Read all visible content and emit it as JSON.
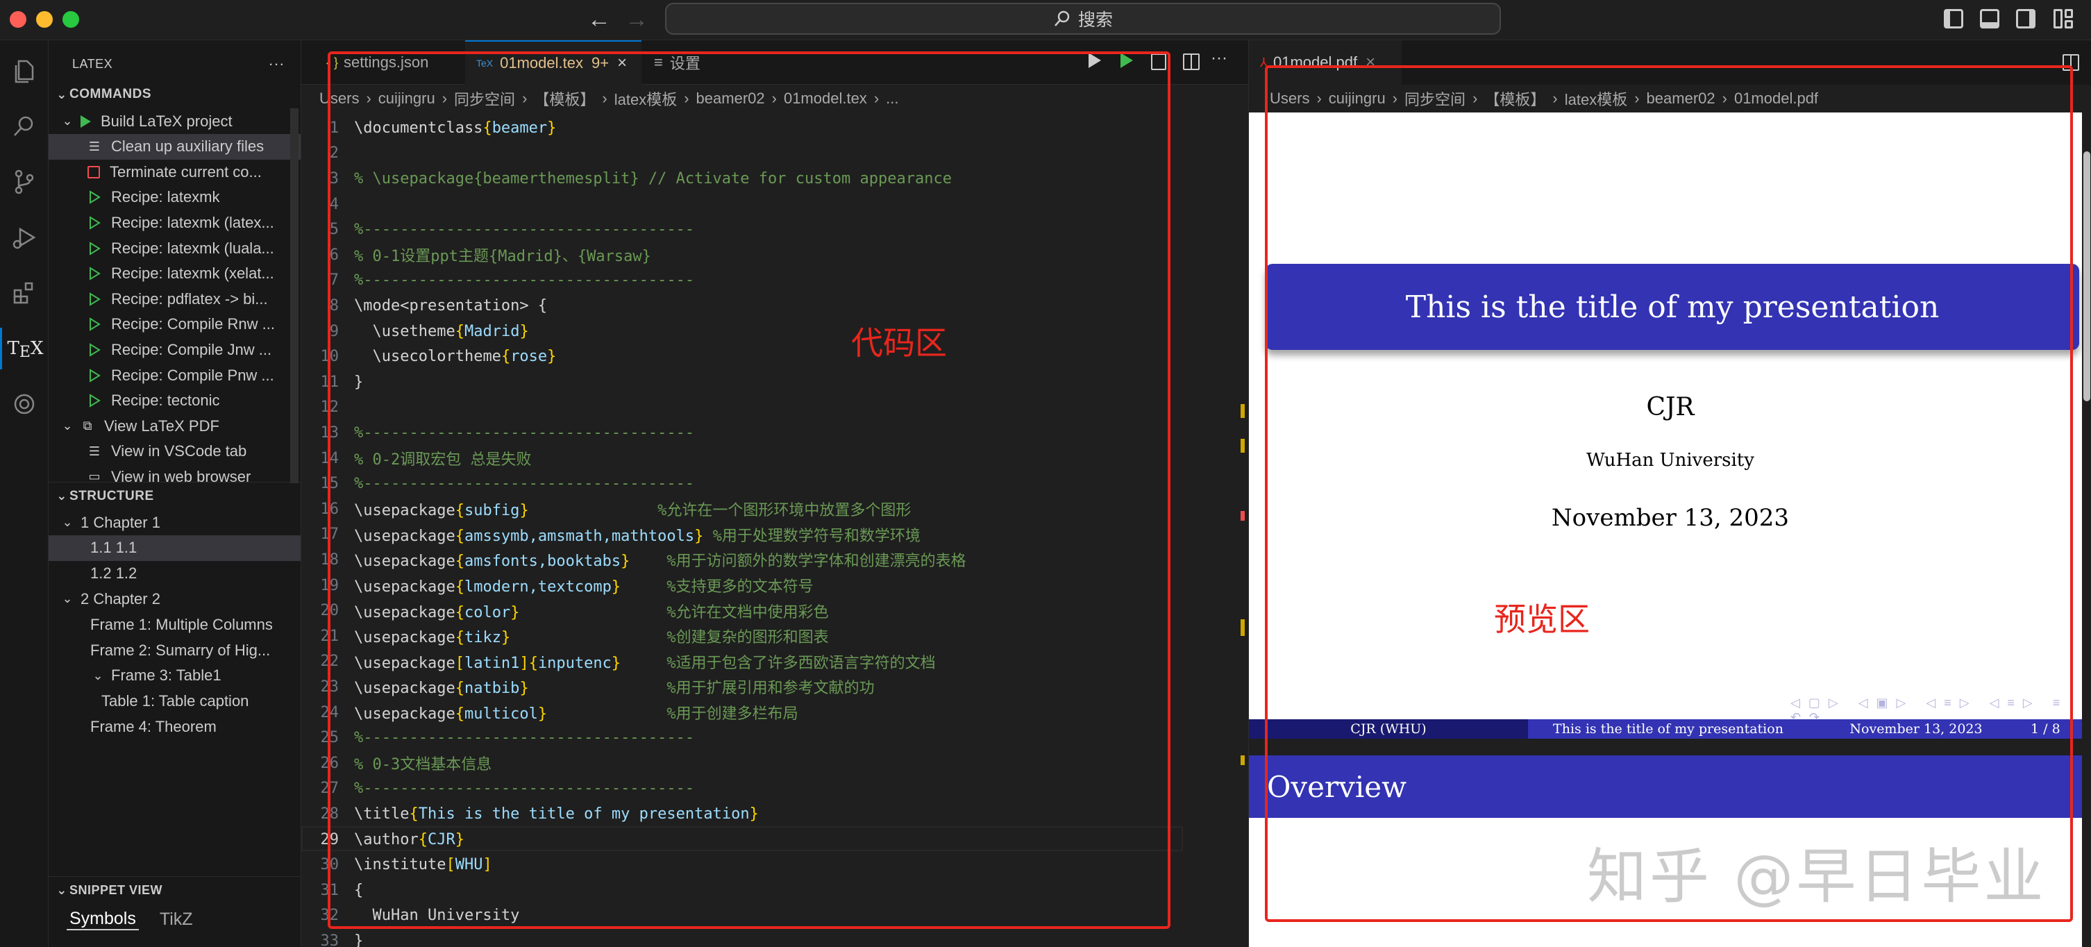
{
  "titlebar": {
    "search": "搜索"
  },
  "sidebar": {
    "view_title": "LATEX",
    "commands_header": "COMMANDS",
    "commands": [
      {
        "label": "Build LaTeX project",
        "icon": "play-icon",
        "indent": 1,
        "chevron": "v"
      },
      {
        "label": "Clean up auxiliary files",
        "icon": "list-icon",
        "indent": 2,
        "selected": true
      },
      {
        "label": "Terminate current co...",
        "icon": "stop-icon",
        "indent": 2
      },
      {
        "label": "Recipe: latexmk",
        "icon": "play-outline-icon",
        "indent": 2
      },
      {
        "label": "Recipe: latexmk (latex...",
        "icon": "play-outline-icon",
        "indent": 2
      },
      {
        "label": "Recipe: latexmk (luala...",
        "icon": "play-outline-icon",
        "indent": 2
      },
      {
        "label": "Recipe: latexmk (xelat...",
        "icon": "play-outline-icon",
        "indent": 2
      },
      {
        "label": "Recipe: pdflatex -> bi...",
        "icon": "play-outline-icon",
        "indent": 2
      },
      {
        "label": "Recipe: Compile Rnw ...",
        "icon": "play-outline-icon",
        "indent": 2
      },
      {
        "label": "Recipe: Compile Jnw ...",
        "icon": "play-outline-icon",
        "indent": 2
      },
      {
        "label": "Recipe: Compile Pnw ...",
        "icon": "play-outline-icon",
        "indent": 2
      },
      {
        "label": "Recipe: tectonic",
        "icon": "play-outline-icon",
        "indent": 2
      },
      {
        "label": "View LaTeX PDF",
        "icon": "preview-icon",
        "indent": 1,
        "chevron": "v"
      },
      {
        "label": "View in VSCode tab",
        "icon": "list-icon",
        "indent": 2
      },
      {
        "label": "View in web browser",
        "icon": "browser-icon",
        "indent": 2
      }
    ],
    "structure_header": "STRUCTURE",
    "structure": [
      {
        "label": "1  Chapter 1",
        "indent": 1,
        "chevron": "v"
      },
      {
        "label": "1.1 1.1",
        "indent": 2,
        "selected": true
      },
      {
        "label": "1.2 1.2",
        "indent": 2
      },
      {
        "label": "2  Chapter 2",
        "indent": 1,
        "chevron": "v"
      },
      {
        "label": "Frame 1: Multiple Columns",
        "indent": 2
      },
      {
        "label": "Frame 2: Sumarry of Hig...",
        "indent": 2
      },
      {
        "label": "Frame 3: Table1",
        "indent": 2,
        "chevron": "v"
      },
      {
        "label": "Table 1: Table caption",
        "indent": 3
      },
      {
        "label": "Frame 4: Theorem",
        "indent": 2
      }
    ],
    "snippet_header": "SNIPPET VIEW",
    "snippet_tabs": [
      "Symbols",
      "TikZ"
    ]
  },
  "editor": {
    "tabs": [
      {
        "label": "settings.json",
        "icon": "{ }"
      },
      {
        "label": "01model.tex",
        "badge": "9+",
        "icon": "TeX",
        "active": true
      },
      {
        "label": "设置",
        "icon": "≡"
      }
    ],
    "breadcrumb": [
      "Users",
      "cuijingru",
      "同步空间",
      "【模板】",
      "latex模板",
      "beamer02",
      "01model.tex",
      "..."
    ],
    "lines": [
      {
        "n": "1",
        "code": "\\documentclass{beamer}"
      },
      {
        "n": "2",
        "code": ""
      },
      {
        "n": "3",
        "code": "% \\usepackage{beamerthemesplit} // Activate for custom appearance"
      },
      {
        "n": "4",
        "code": ""
      },
      {
        "n": "5",
        "code": "%------------------------------------"
      },
      {
        "n": "6",
        "code": "% 0-1设置ppt主题{Madrid}、{Warsaw}"
      },
      {
        "n": "7",
        "code": "%------------------------------------"
      },
      {
        "n": "8",
        "code": "\\mode<presentation> {"
      },
      {
        "n": "9",
        "code": "  \\usetheme{Madrid}"
      },
      {
        "n": "10",
        "code": "  \\usecolortheme{rose}"
      },
      {
        "n": "11",
        "code": "}"
      },
      {
        "n": "12",
        "code": ""
      },
      {
        "n": "13",
        "code": "%------------------------------------"
      },
      {
        "n": "14",
        "code": "% 0-2调取宏包 总是失败"
      },
      {
        "n": "15",
        "code": "%------------------------------------"
      },
      {
        "n": "16",
        "code": "\\usepackage{subfig}              %允许在一个图形环境中放置多个图形"
      },
      {
        "n": "17",
        "code": "\\usepackage{amssymb,amsmath,mathtools} %用于处理数学符号和数学环境"
      },
      {
        "n": "18",
        "code": "\\usepackage{amsfonts,booktabs}    %用于访问额外的数学字体和创建漂亮的表格"
      },
      {
        "n": "19",
        "code": "\\usepackage{lmodern,textcomp}     %支持更多的文本符号"
      },
      {
        "n": "20",
        "code": "\\usepackage{color}                %允许在文档中使用彩色"
      },
      {
        "n": "21",
        "code": "\\usepackage{tikz}                 %创建复杂的图形和图表"
      },
      {
        "n": "22",
        "code": "\\usepackage[latin1]{inputenc}     %适用于包含了许多西欧语言字符的文档"
      },
      {
        "n": "23",
        "code": "\\usepackage{natbib}               %用于扩展引用和参考文献的功"
      },
      {
        "n": "24",
        "code": "\\usepackage{multicol}             %用于创建多栏布局"
      },
      {
        "n": "25",
        "code": "%------------------------------------"
      },
      {
        "n": "26",
        "code": "% 0-3文档基本信息"
      },
      {
        "n": "27",
        "code": "%------------------------------------"
      },
      {
        "n": "28",
        "code": "\\title{This is the title of my presentation}"
      },
      {
        "n": "29",
        "code": "\\author{CJR}",
        "current": true
      },
      {
        "n": "30",
        "code": "\\institute[WHU]"
      },
      {
        "n": "31",
        "code": "{"
      },
      {
        "n": "32",
        "code": "  WuHan University"
      },
      {
        "n": "33",
        "code": "}"
      }
    ]
  },
  "preview": {
    "tab": "01model.pdf",
    "breadcrumb": [
      "Users",
      "cuijingru",
      "同步空间",
      "【模板】",
      "latex模板",
      "beamer02",
      "01model.pdf"
    ],
    "slide": {
      "title": "This is the title of my presentation",
      "author": "CJR",
      "institute": "WuHan University",
      "date": "November 13, 2023",
      "footer": [
        "CJR  (WHU)",
        "This is the title of my presentation",
        "November 13, 2023",
        "1 / 8"
      ],
      "next_title": "Overview"
    }
  },
  "annotations": {
    "code_label": "代码区",
    "preview_label": "预览区",
    "watermark": "知乎 @早日毕业"
  },
  "colors": {
    "accent": "#0078d4",
    "annotation_red": "#e8261d",
    "beamer_blue": "#3333b3",
    "beamer_dark": "#191970",
    "tex_keyword": "#c586c0",
    "tex_brace": "#ffd700",
    "comment": "#6a9955"
  }
}
